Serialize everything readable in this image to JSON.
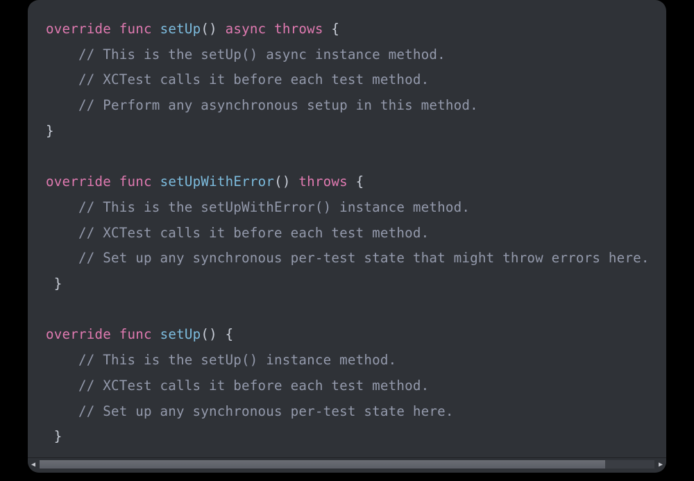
{
  "code": {
    "lines": [
      {
        "tokens": [
          {
            "cls": "tok-override",
            "text": "override"
          },
          {
            "cls": "",
            "text": " "
          },
          {
            "cls": "tok-func",
            "text": "func"
          },
          {
            "cls": "",
            "text": " "
          },
          {
            "cls": "tok-name",
            "text": "setUp"
          },
          {
            "cls": "tok-punct",
            "text": "()"
          },
          {
            "cls": "",
            "text": " "
          },
          {
            "cls": "tok-async",
            "text": "async"
          },
          {
            "cls": "",
            "text": " "
          },
          {
            "cls": "tok-throws",
            "text": "throws"
          },
          {
            "cls": "",
            "text": " "
          },
          {
            "cls": "tok-punct",
            "text": "{"
          }
        ]
      },
      {
        "tokens": [
          {
            "cls": "",
            "text": "    "
          },
          {
            "cls": "tok-comment",
            "text": "// This is the setUp() async instance method."
          }
        ]
      },
      {
        "tokens": [
          {
            "cls": "",
            "text": "    "
          },
          {
            "cls": "tok-comment",
            "text": "// XCTest calls it before each test method."
          }
        ]
      },
      {
        "tokens": [
          {
            "cls": "",
            "text": "    "
          },
          {
            "cls": "tok-comment",
            "text": "// Perform any asynchronous setup in this method."
          }
        ]
      },
      {
        "tokens": [
          {
            "cls": "tok-punct",
            "text": "}"
          }
        ]
      },
      {
        "blank": true
      },
      {
        "tokens": [
          {
            "cls": "tok-override",
            "text": "override"
          },
          {
            "cls": "",
            "text": " "
          },
          {
            "cls": "tok-func",
            "text": "func"
          },
          {
            "cls": "",
            "text": " "
          },
          {
            "cls": "tok-name",
            "text": "setUpWithError"
          },
          {
            "cls": "tok-punct",
            "text": "()"
          },
          {
            "cls": "",
            "text": " "
          },
          {
            "cls": "tok-throws",
            "text": "throws"
          },
          {
            "cls": "",
            "text": " "
          },
          {
            "cls": "tok-punct",
            "text": "{"
          }
        ]
      },
      {
        "tokens": [
          {
            "cls": "",
            "text": "    "
          },
          {
            "cls": "tok-comment",
            "text": "// This is the setUpWithError() instance method."
          }
        ]
      },
      {
        "tokens": [
          {
            "cls": "",
            "text": "    "
          },
          {
            "cls": "tok-comment",
            "text": "// XCTest calls it before each test method."
          }
        ]
      },
      {
        "tokens": [
          {
            "cls": "",
            "text": "    "
          },
          {
            "cls": "tok-comment",
            "text": "// Set up any synchronous per-test state that might throw errors here."
          }
        ]
      },
      {
        "tokens": [
          {
            "cls": "",
            "text": " "
          },
          {
            "cls": "tok-punct",
            "text": "}"
          }
        ]
      },
      {
        "blank": true
      },
      {
        "tokens": [
          {
            "cls": "tok-override",
            "text": "override"
          },
          {
            "cls": "",
            "text": " "
          },
          {
            "cls": "tok-func",
            "text": "func"
          },
          {
            "cls": "",
            "text": " "
          },
          {
            "cls": "tok-name",
            "text": "setUp"
          },
          {
            "cls": "tok-punct",
            "text": "()"
          },
          {
            "cls": "",
            "text": " "
          },
          {
            "cls": "tok-punct",
            "text": "{"
          }
        ]
      },
      {
        "tokens": [
          {
            "cls": "",
            "text": "    "
          },
          {
            "cls": "tok-comment",
            "text": "// This is the setUp() instance method."
          }
        ]
      },
      {
        "tokens": [
          {
            "cls": "",
            "text": "    "
          },
          {
            "cls": "tok-comment",
            "text": "// XCTest calls it before each test method."
          }
        ]
      },
      {
        "tokens": [
          {
            "cls": "",
            "text": "    "
          },
          {
            "cls": "tok-comment",
            "text": "// Set up any synchronous per-test state here."
          }
        ]
      },
      {
        "tokens": [
          {
            "cls": "",
            "text": " "
          },
          {
            "cls": "tok-punct",
            "text": "}"
          }
        ]
      }
    ]
  },
  "scrollbar": {
    "arrow_left": "◀",
    "arrow_right": "▶"
  }
}
